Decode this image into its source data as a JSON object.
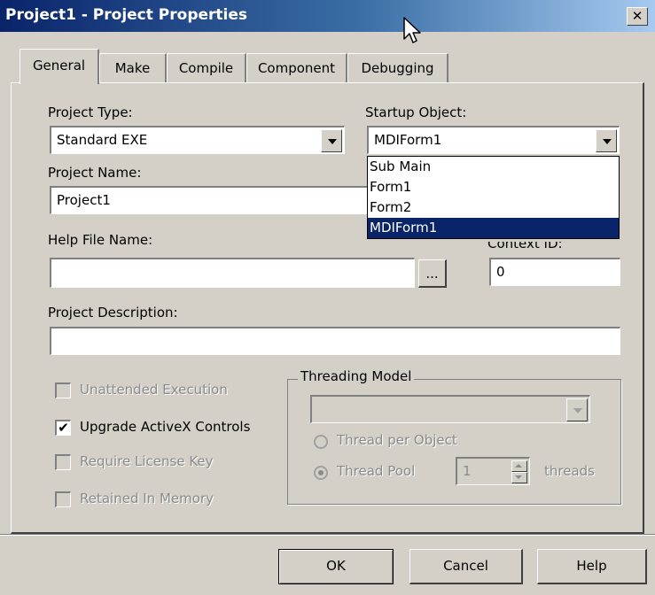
{
  "window": {
    "title": "Project1 - Project Properties",
    "close_glyph": "✕"
  },
  "tabs": [
    {
      "label": "General",
      "active": true
    },
    {
      "label": "Make"
    },
    {
      "label": "Compile"
    },
    {
      "label": "Component"
    },
    {
      "label": "Debugging"
    }
  ],
  "general": {
    "project_type_label": "Project Type:",
    "project_type_value": "Standard EXE",
    "startup_object_label": "Startup Object:",
    "startup_object_value": "MDIForm1",
    "startup_options": [
      "Sub Main",
      "Form1",
      "Form2",
      "MDIForm1"
    ],
    "startup_selected": "MDIForm1",
    "project_name_label": "Project Name:",
    "project_name_value": "Project1",
    "help_file_label": "Help File Name:",
    "help_file_value": "",
    "browse_label": "...",
    "context_id_label": "Context ID:",
    "context_id_value": "0",
    "project_description_label": "Project Description:",
    "project_description_value": "",
    "checkboxes": [
      {
        "label": "Unattended Execution",
        "checked": false,
        "enabled": false
      },
      {
        "label": "Upgrade ActiveX Controls",
        "checked": true,
        "enabled": true
      },
      {
        "label": "Require License Key",
        "checked": false,
        "enabled": false
      },
      {
        "label": "Retained In Memory",
        "checked": false,
        "enabled": false
      }
    ],
    "check_glyph": "✔",
    "threading_model": {
      "legend": "Threading Model",
      "dropdown_value": "",
      "thread_per_object_label": "Thread per Object",
      "thread_pool_label": "Thread Pool",
      "selected": "Thread Pool",
      "pool_value": "1",
      "threads_label": "threads"
    }
  },
  "buttons": {
    "ok": "OK",
    "cancel": "Cancel",
    "help": "Help"
  },
  "colors": {
    "title_bar": "#0a246a",
    "dialog_face": "#d4d0c8",
    "selection": "#0a246a"
  }
}
